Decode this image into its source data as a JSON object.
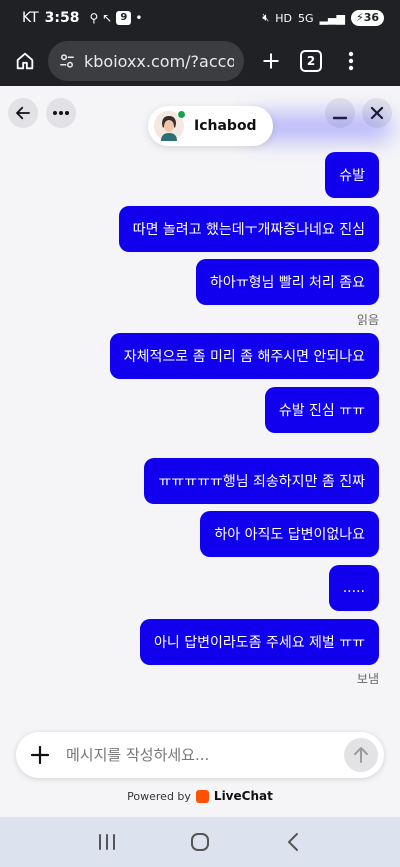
{
  "statusbar": {
    "carrier": "KT",
    "time": "3:58",
    "notif_badge": "9",
    "net_type": "5G",
    "battery": "36"
  },
  "browser": {
    "url": "kboioxx.com/?accou",
    "tab_count": "2"
  },
  "chat": {
    "agent_name": "Ichabod",
    "messages": [
      {
        "text": "슈발"
      },
      {
        "text": "따면 놀려고 했는데ㅜ개짜증나네요 진심"
      },
      {
        "text": "하아ㅠ형님 빨리 처리 좀요"
      },
      {
        "text": "자체적으로 좀 미리 좀 해주시면 안되나요"
      },
      {
        "text": "슈발 진심 ㅠㅠ"
      },
      {
        "text": "ㅠㅠㅠㅠㅠ행님 죄송하지만 좀 진짜"
      },
      {
        "text": "하아 아직도 답변이없나요"
      },
      {
        "text": "....."
      },
      {
        "text": "아니 답변이라도좀 주세요 제벌 ㅠㅠ"
      }
    ],
    "read_status": "읽음",
    "sent_status": "보냄"
  },
  "composer": {
    "placeholder": "메시지를 작성하세요..."
  },
  "footer": {
    "powered_by": "Powered by",
    "brand": "LiveChat"
  },
  "colors": {
    "bubble": "#1100ee",
    "status_bar": "#202124",
    "nav_bar": "#dde3ee",
    "online": "#17a34a",
    "brand": "#ff5100"
  }
}
